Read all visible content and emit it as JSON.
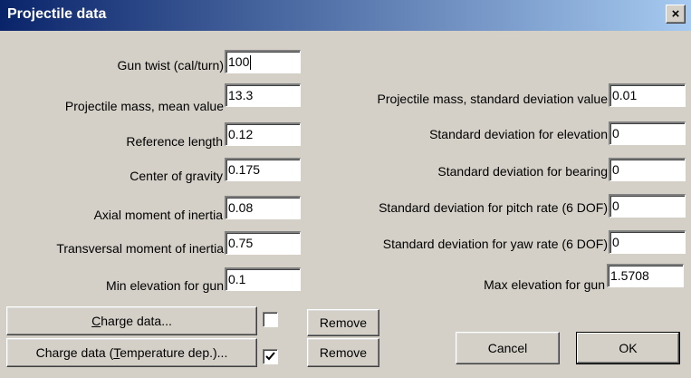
{
  "window": {
    "title": "Projectile data",
    "close_glyph": "×"
  },
  "left_fields": [
    {
      "label": "Gun twist (cal/turn)",
      "value": "100"
    },
    {
      "label": "Projectile mass, mean value",
      "value": "13.3"
    },
    {
      "label": "Reference length",
      "value": "0.12"
    },
    {
      "label": "Center of gravity",
      "value": "0.175"
    },
    {
      "label": "Axial moment of inertia",
      "value": "0.08"
    },
    {
      "label": "Transversal moment of inertia",
      "value": "0.75"
    },
    {
      "label": "Min elevation for gun",
      "value": "0.1"
    }
  ],
  "right_fields": [
    {
      "label": "Projectile mass, standard deviation value",
      "value": "0.01"
    },
    {
      "label": "Standard deviation for elevation",
      "value": "0"
    },
    {
      "label": "Standard deviation for bearing",
      "value": "0"
    },
    {
      "label": "Standard deviation for pitch rate (6 DOF)",
      "value": "0"
    },
    {
      "label": "Standard deviation for yaw rate (6 DOF)",
      "value": "0"
    },
    {
      "label": "Max elevation for gun",
      "value": "1.5708"
    }
  ],
  "charge_rows": [
    {
      "button_pre": "",
      "button_mnemonic": "C",
      "button_post": "harge data...",
      "checked": false,
      "remove_label": "Remove"
    },
    {
      "button_pre": "Charge data (",
      "button_mnemonic": "T",
      "button_post": "emperature dep.)...",
      "checked": true,
      "remove_label": "Remove"
    }
  ],
  "actions": {
    "cancel_label": "Cancel",
    "ok_label": "OK"
  },
  "icons": {
    "close": "close-icon",
    "check": "checkmark-icon"
  }
}
